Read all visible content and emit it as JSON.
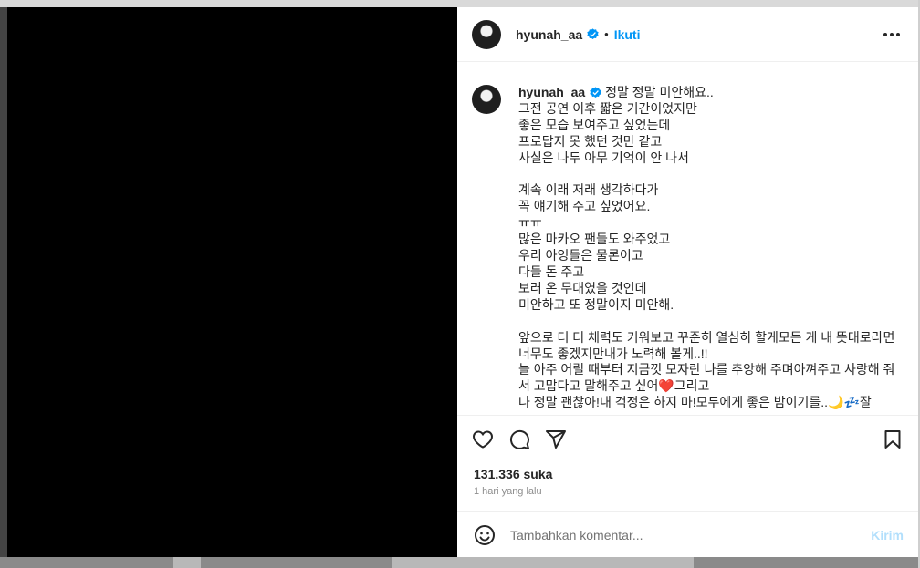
{
  "header": {
    "username": "hyunah_aa",
    "dot": "•",
    "follow_label": "Ikuti",
    "verified_icon": "verified-badge-icon",
    "more_icon": "more-options-icon"
  },
  "caption": {
    "username": "hyunah_aa",
    "text": "정말 정말 미안해요..\n그전 공연 이후 짧은 기간이었지만\n좋은 모습 보여주고 싶었는데\n프로답지 못 했던 것만 같고\n사실은 나두 아무 기억이 안 나서\n\n계속 이래 저래 생각하다가\n꼭 얘기해 주고 싶었어요.\nㅠㅠ\n많은 마카오 팬들도 와주었고\n우리 아잉들은 물론이고\n다들 돈 주고\n보러 온 무대였을 것인데\n미안하고 또 정말이지 미안해.\n\n앞으로 더 더 체력도 키워보고 꾸준히 열심히 할게모든 게 내 뜻대로라면 너무도 좋겠지만내가 노력해 볼게..!!\n늘 아주 어릴 때부터 지금껏 모자란 나를 추앙해 주며아껴주고 사랑해 줘서 고맙다고 말해주고 싶어❤️그리고\n나 정말 괜찮아!내 걱정은 하지 마!모두에게 좋은 밤이기를..🌙💤잘"
  },
  "actions": {
    "like_icon": "heart-icon",
    "comment_icon": "comment-icon",
    "share_icon": "share-icon",
    "save_icon": "bookmark-icon"
  },
  "likes": "131.336 suka",
  "timestamp": "1 hari yang lalu",
  "comment": {
    "placeholder": "Tambahkan komentar...",
    "post_label": "Kirim",
    "emoji_icon": "emoji-icon"
  },
  "colors": {
    "accent": "#0095f6",
    "post_disabled": "#b2dffc",
    "text": "#262626",
    "muted": "#8e8e8e",
    "media_bg": "#000000"
  }
}
